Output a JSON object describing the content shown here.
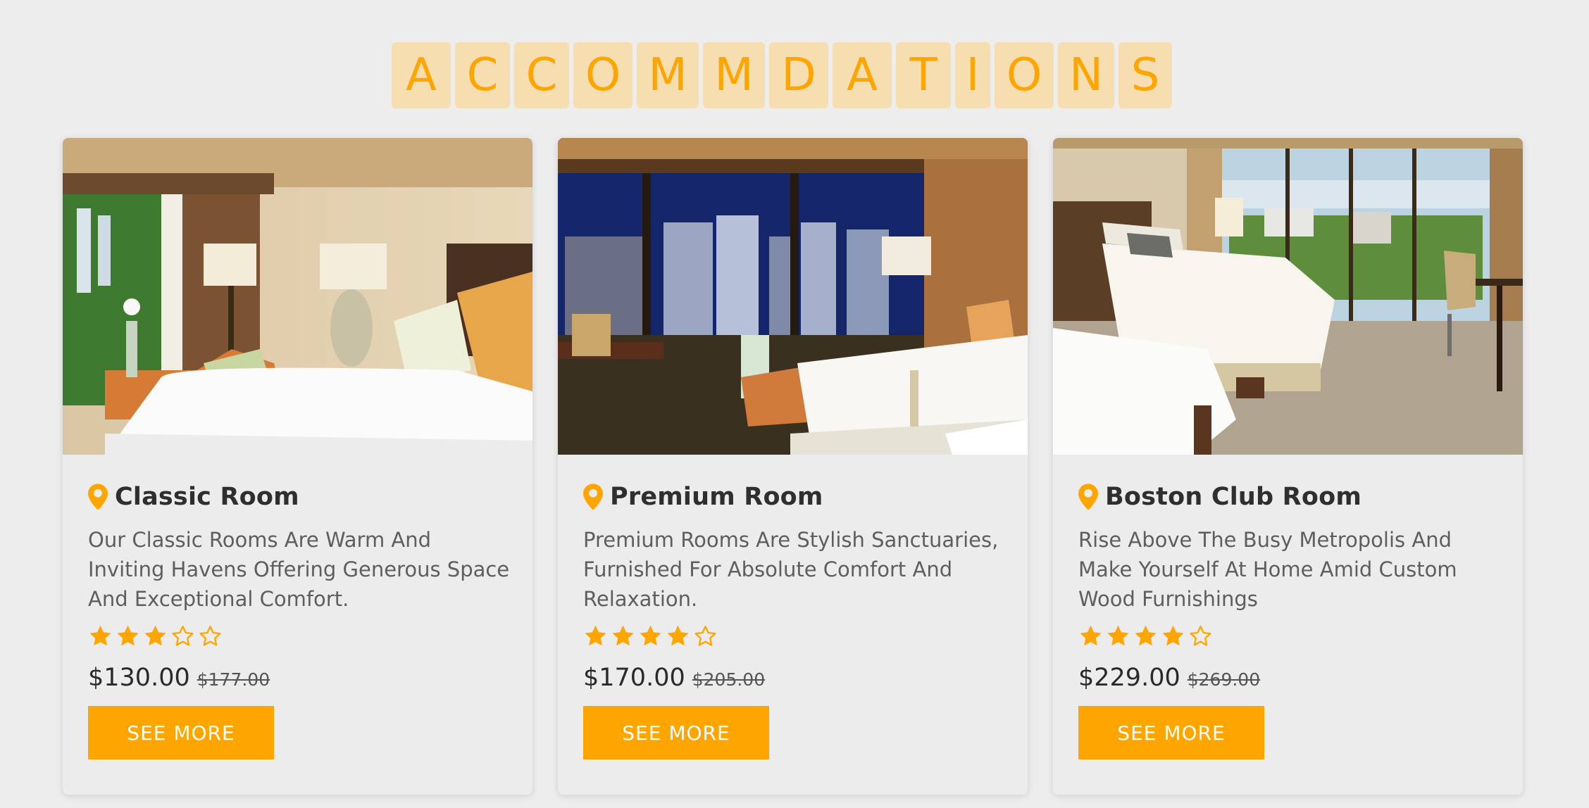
{
  "heading": {
    "letters": [
      "A",
      "C",
      "C",
      "O",
      "M",
      "M",
      "D",
      "A",
      "T",
      "I",
      "O",
      "N",
      "S"
    ]
  },
  "colors": {
    "accent": "#ffa500",
    "tile_bg": "#f7deb1",
    "page_bg": "#ededed"
  },
  "cards": [
    {
      "title": "Classic Room",
      "description": "Our Classic Rooms Are Warm And Inviting Havens Offering Generous Space And Exceptional Comfort.",
      "rating": 3,
      "max_rating": 5,
      "price": "$130.00",
      "old_price": "$177.00",
      "button_label": "SEE MORE",
      "image": "hotel room with white bed, lamps and orange armchair by window with trees"
    },
    {
      "title": "Premium Room",
      "description": "Premium Rooms Are Stylish Sanctuaries, Furnished For Absolute Comfort And Relaxation.",
      "rating": 4,
      "max_rating": 5,
      "price": "$170.00",
      "old_price": "$205.00",
      "button_label": "SEE MORE",
      "image": "hotel room at night with city skyline window, desk and bed"
    },
    {
      "title": "Boston Club Room",
      "description": "Rise Above The Busy Metropolis And Make Yourself At Home Amid Custom Wood Furnishings",
      "rating": 4,
      "max_rating": 5,
      "price": "$229.00",
      "old_price": "$269.00",
      "button_label": "SEE MORE",
      "image": "bright hotel room with twin beds, carpet, desk and floor-to-ceiling windows"
    }
  ]
}
